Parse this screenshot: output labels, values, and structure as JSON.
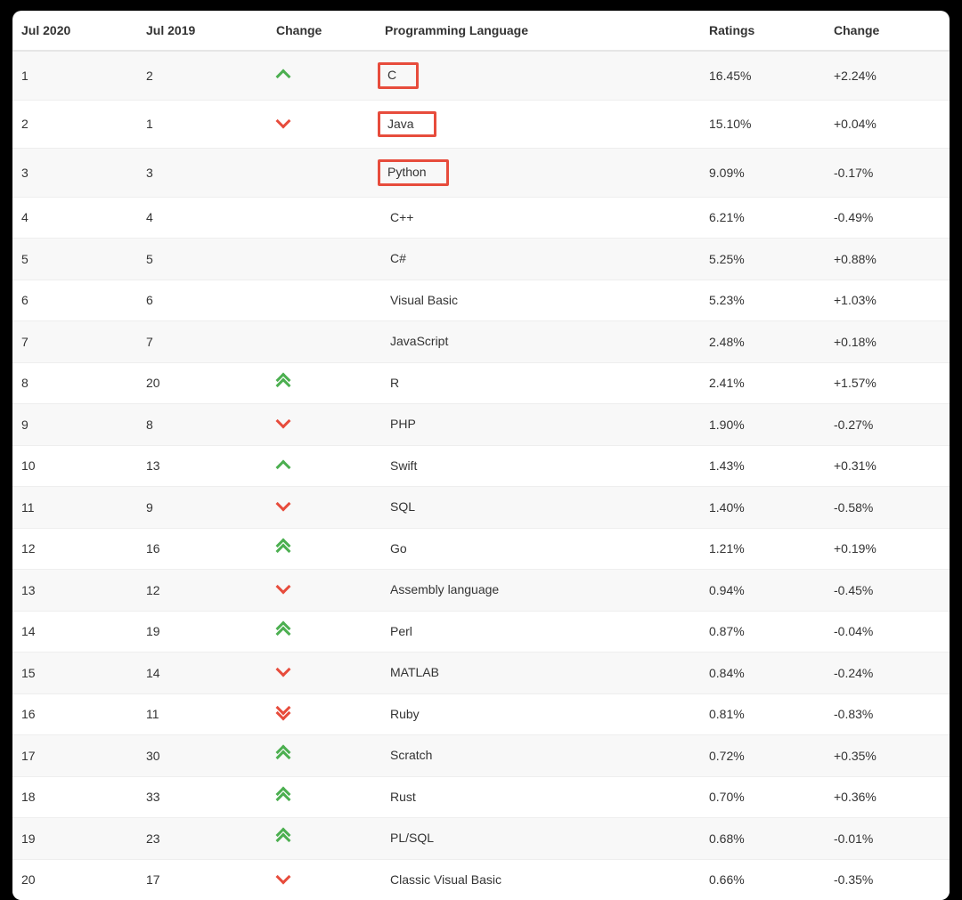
{
  "table": {
    "columns": {
      "jul2020": "Jul 2020",
      "jul2019": "Jul 2019",
      "change": "Change",
      "language": "Programming Language",
      "ratings": "Ratings",
      "delta": "Change"
    },
    "rows": [
      {
        "jul2020": "1",
        "jul2019": "2",
        "change": "up",
        "language": "C",
        "ratings": "16.45%",
        "delta": "+2.24%",
        "highlight": true
      },
      {
        "jul2020": "2",
        "jul2019": "1",
        "change": "down",
        "language": "Java",
        "ratings": "15.10%",
        "delta": "+0.04%",
        "highlight": true
      },
      {
        "jul2020": "3",
        "jul2019": "3",
        "change": "",
        "language": "Python",
        "ratings": "9.09%",
        "delta": "-0.17%",
        "highlight": true
      },
      {
        "jul2020": "4",
        "jul2019": "4",
        "change": "",
        "language": "C++",
        "ratings": "6.21%",
        "delta": "-0.49%",
        "highlight": false
      },
      {
        "jul2020": "5",
        "jul2019": "5",
        "change": "",
        "language": "C#",
        "ratings": "5.25%",
        "delta": "+0.88%",
        "highlight": false
      },
      {
        "jul2020": "6",
        "jul2019": "6",
        "change": "",
        "language": "Visual Basic",
        "ratings": "5.23%",
        "delta": "+1.03%",
        "highlight": false
      },
      {
        "jul2020": "7",
        "jul2019": "7",
        "change": "",
        "language": "JavaScript",
        "ratings": "2.48%",
        "delta": "+0.18%",
        "highlight": false
      },
      {
        "jul2020": "8",
        "jul2019": "20",
        "change": "up2",
        "language": "R",
        "ratings": "2.41%",
        "delta": "+1.57%",
        "highlight": false
      },
      {
        "jul2020": "9",
        "jul2019": "8",
        "change": "down",
        "language": "PHP",
        "ratings": "1.90%",
        "delta": "-0.27%",
        "highlight": false
      },
      {
        "jul2020": "10",
        "jul2019": "13",
        "change": "up",
        "language": "Swift",
        "ratings": "1.43%",
        "delta": "+0.31%",
        "highlight": false
      },
      {
        "jul2020": "11",
        "jul2019": "9",
        "change": "down",
        "language": "SQL",
        "ratings": "1.40%",
        "delta": "-0.58%",
        "highlight": false
      },
      {
        "jul2020": "12",
        "jul2019": "16",
        "change": "up2",
        "language": "Go",
        "ratings": "1.21%",
        "delta": "+0.19%",
        "highlight": false
      },
      {
        "jul2020": "13",
        "jul2019": "12",
        "change": "down",
        "language": "Assembly language",
        "ratings": "0.94%",
        "delta": "-0.45%",
        "highlight": false
      },
      {
        "jul2020": "14",
        "jul2019": "19",
        "change": "up2",
        "language": "Perl",
        "ratings": "0.87%",
        "delta": "-0.04%",
        "highlight": false
      },
      {
        "jul2020": "15",
        "jul2019": "14",
        "change": "down",
        "language": "MATLAB",
        "ratings": "0.84%",
        "delta": "-0.24%",
        "highlight": false
      },
      {
        "jul2020": "16",
        "jul2019": "11",
        "change": "down2",
        "language": "Ruby",
        "ratings": "0.81%",
        "delta": "-0.83%",
        "highlight": false
      },
      {
        "jul2020": "17",
        "jul2019": "30",
        "change": "up2",
        "language": "Scratch",
        "ratings": "0.72%",
        "delta": "+0.35%",
        "highlight": false
      },
      {
        "jul2020": "18",
        "jul2019": "33",
        "change": "up2",
        "language": "Rust",
        "ratings": "0.70%",
        "delta": "+0.36%",
        "highlight": false
      },
      {
        "jul2020": "19",
        "jul2019": "23",
        "change": "up2",
        "language": "PL/SQL",
        "ratings": "0.68%",
        "delta": "-0.01%",
        "highlight": false
      },
      {
        "jul2020": "20",
        "jul2019": "17",
        "change": "down",
        "language": "Classic Visual Basic",
        "ratings": "0.66%",
        "delta": "-0.35%",
        "highlight": false
      }
    ]
  }
}
